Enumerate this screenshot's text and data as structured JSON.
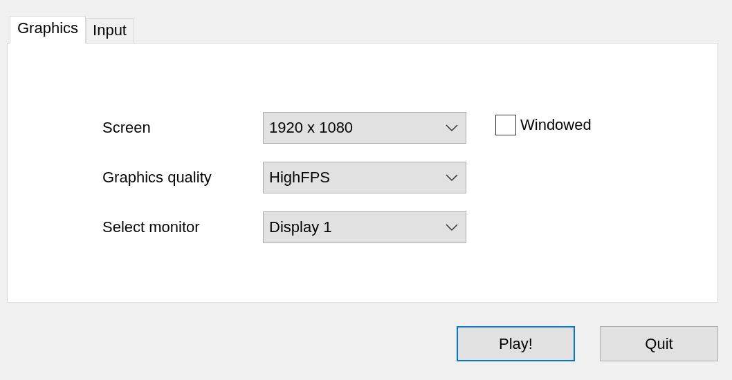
{
  "tabs": [
    {
      "label": "Graphics",
      "selected": true
    },
    {
      "label": "Input",
      "selected": false
    }
  ],
  "settings": [
    {
      "label": "Screen",
      "value": "1920 x 1080"
    },
    {
      "label": "Graphics quality",
      "value": "HighFPS"
    },
    {
      "label": "Select monitor",
      "value": "Display 1"
    }
  ],
  "windowed": {
    "label": "Windowed",
    "checked": false
  },
  "buttons": [
    {
      "label": "Play!",
      "selected": true
    },
    {
      "label": "Quit",
      "selected": false
    }
  ]
}
